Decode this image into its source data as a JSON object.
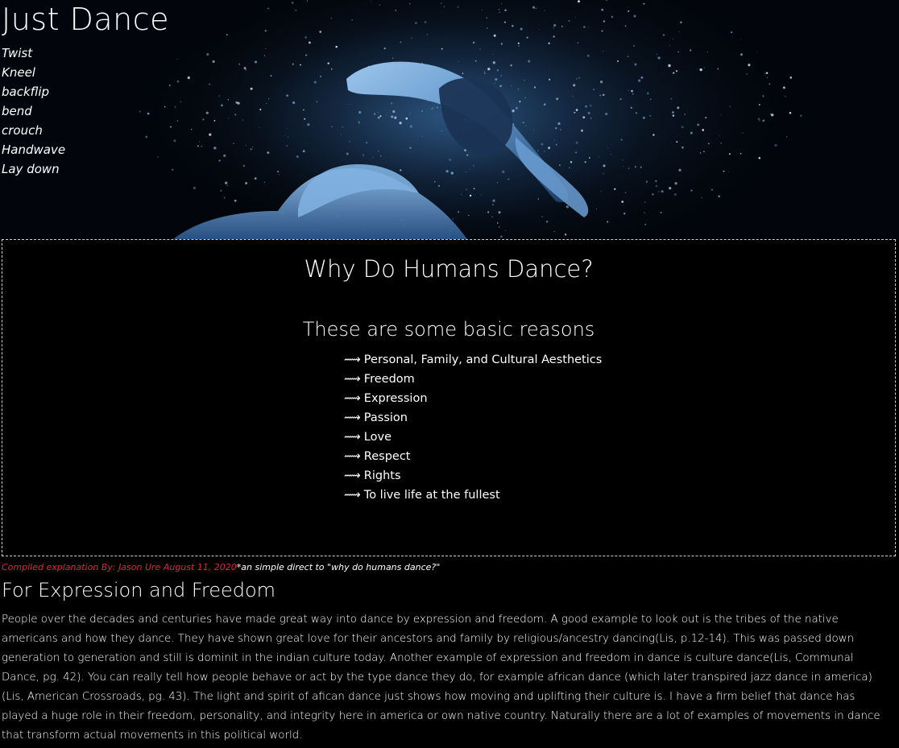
{
  "header": {
    "site_title": "Just Dance",
    "moves": [
      "Twist",
      "Kneel",
      "backflip",
      "bend",
      "crouch",
      "Handwave",
      "Lay down"
    ],
    "hero_image_icon": "dancer-silhouette-image"
  },
  "reasons": {
    "heading": "Why Do Humans Dance?",
    "subheading": "These are some basic reasons",
    "arrow": "⟿",
    "items": [
      "Personal, Family, and Cultural Aesthetics",
      "Freedom",
      "Expression",
      "Passion",
      "Love",
      "Respect",
      "Rights",
      "To live life at the fullest"
    ]
  },
  "credit": {
    "author": "Compiled explanation By: Jason Ure August 11, 2020",
    "note": "*an simple direct to \"why do humans dance?\""
  },
  "article": {
    "title": "For Expression and Freedom",
    "body": "People over the decades and centuries have made great way into dance by expression and freedom. A good example to look out is the tribes of the native americans and how they dance. They have shown great love for their ancestors and family by religious/ancestry dancing(Lis, p.12-14). This was passed down generation to generation and still is dominit in the indian culture today. Another example of expression and freedom in dance is culture dance(Lis, Communal Dance, pg. 42). You can really tell how people behave or act by the type dance they do, for example african dance (which later transpired jazz dance in america)(Lis, American Crossroads, pg. 43). The light and spirit of afican dance just shows how moving and uplifting their culture is. I have a firm belief that dance has played a huge role in their freedom, personality, and integrity here in america or own native country. Naturally there are a lot of examples of movements in dance that transform actual movements in this political world."
  },
  "colors": {
    "background": "#000000",
    "text": "#ffffff",
    "accent_red": "#e0263a",
    "hero_blue": "#5a8fc4"
  }
}
